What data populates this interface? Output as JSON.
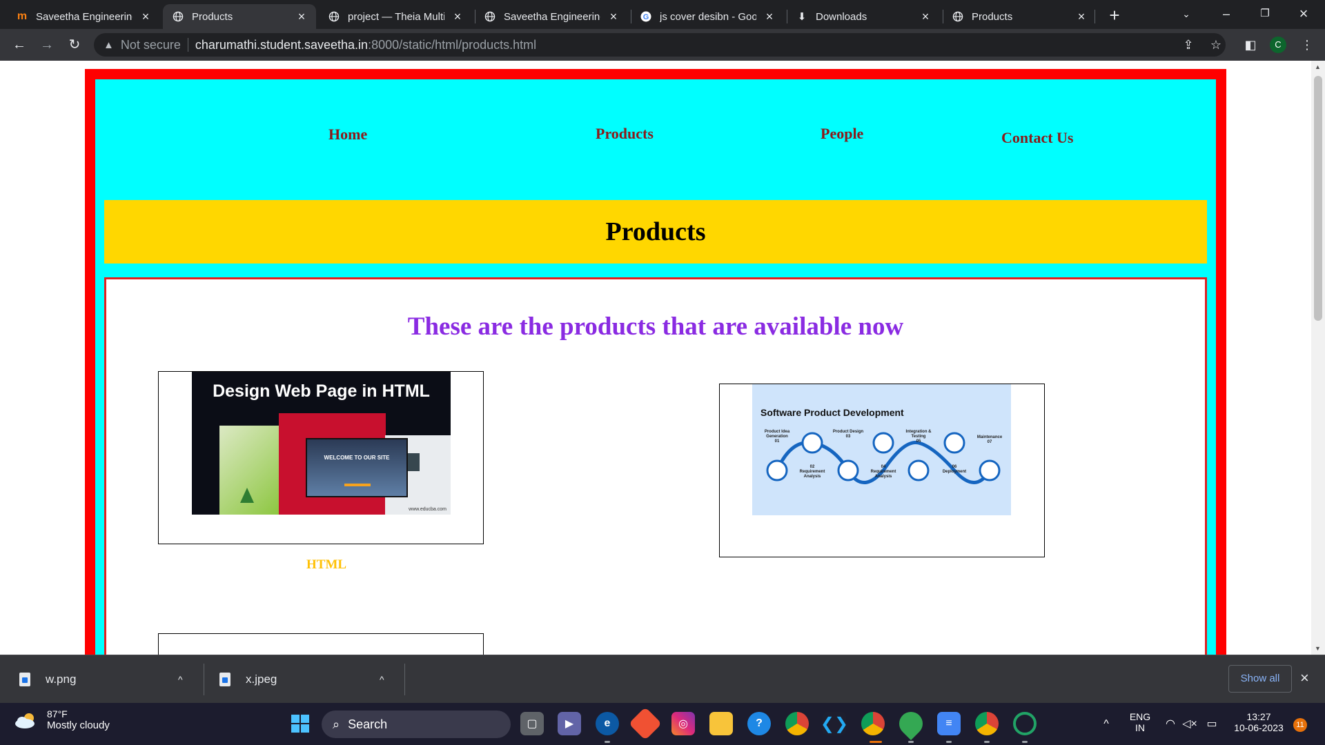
{
  "browser": {
    "tabs": [
      {
        "title": "Saveetha Engineering",
        "favicon": "moodle-icon",
        "active": false
      },
      {
        "title": "Products",
        "favicon": "globe-icon",
        "active": true
      },
      {
        "title": "project — Theia Multi",
        "favicon": "globe-icon",
        "active": false
      },
      {
        "title": "Saveetha Engineering",
        "favicon": "globe-icon",
        "active": false
      },
      {
        "title": "js cover desibn - Goo",
        "favicon": "google-icon",
        "active": false
      },
      {
        "title": "Downloads",
        "favicon": "download-icon",
        "active": false
      },
      {
        "title": "Products",
        "favicon": "globe-icon",
        "active": false
      }
    ],
    "address": {
      "security_label": "Not secure",
      "host": "charumathi.student.saveetha.in",
      "path": ":8000/static/html/products.html"
    },
    "profile_initial": "C"
  },
  "page": {
    "nav": {
      "home": "Home",
      "products": "Products",
      "people": "People",
      "contact": "Contact Us"
    },
    "banner_title": "Products",
    "heading": "These are the products that are available now",
    "cards": [
      {
        "image_title": "Design Web Page in HTML",
        "image_site": "www.educba.com",
        "image_welcome": "WELCOME TO OUR SITE",
        "label": "HTML"
      },
      {
        "image_title": "Software Product Development",
        "steps_top": [
          {
            "num": "01",
            "text": "Product Idea Generation"
          },
          {
            "num": "03",
            "text": "Product Design"
          },
          {
            "num": "05",
            "text": "Integration & Testing"
          },
          {
            "num": "07",
            "text": "Maintenance"
          }
        ],
        "steps_bottom": [
          {
            "num": "02",
            "text": "Requirement Analysis"
          },
          {
            "num": "04",
            "text": "Requirement Analysis"
          },
          {
            "num": "06",
            "text": "Deployment"
          }
        ]
      }
    ]
  },
  "downloads": {
    "items": [
      "w.png",
      "x.jpeg"
    ],
    "show_all": "Show all"
  },
  "taskbar": {
    "weather_temp": "87°F",
    "weather_desc": "Mostly cloudy",
    "search_placeholder": "Search",
    "lang_top": "ENG",
    "lang_bottom": "IN",
    "time": "13:27",
    "date": "10-06-2023",
    "notification_count": "11"
  },
  "colors": {
    "outer_border": "#ff0000",
    "page_bg": "#00ffff",
    "banner_bg": "#ffd700",
    "heading": "#8a2be2",
    "nav_text": "#8b1a1a",
    "card_label": "#ffc107"
  }
}
